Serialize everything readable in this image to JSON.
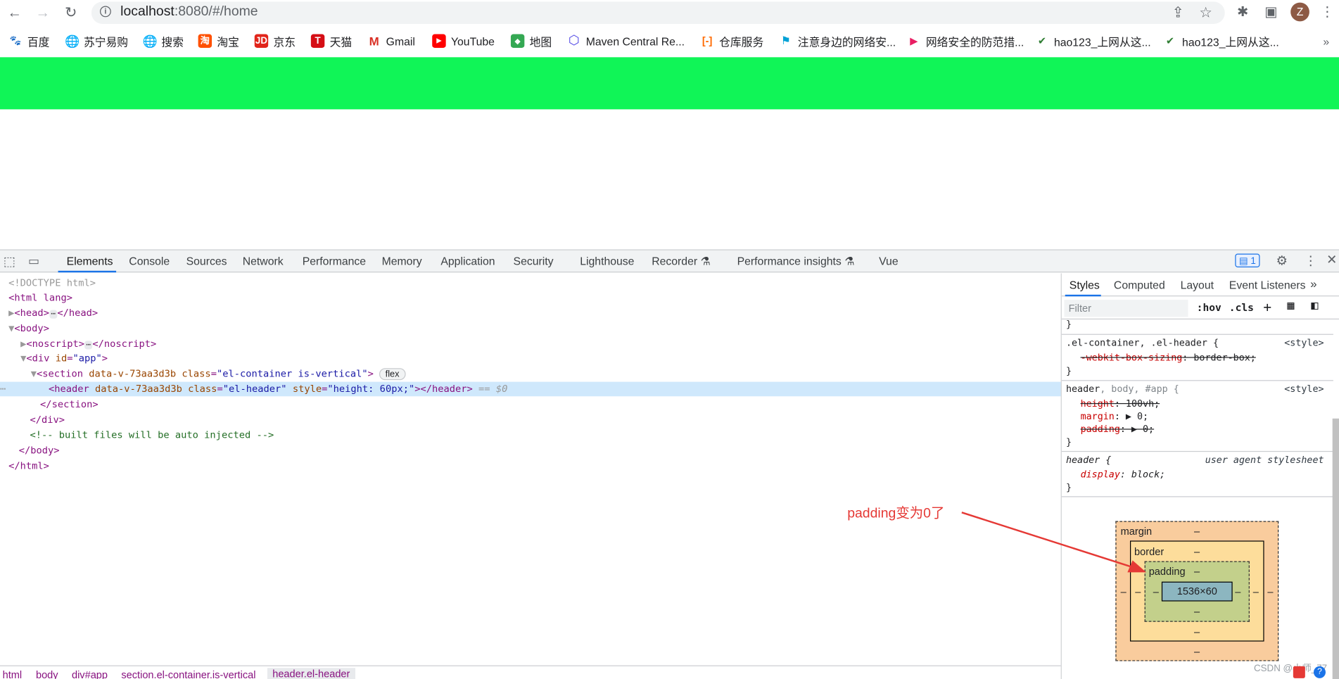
{
  "browser": {
    "url_host": "localhost",
    "url_rest": ":8080/#/home",
    "avatar_letter": "Z",
    "bookmarks": [
      {
        "label": "百度",
        "icon": "baidu-icon",
        "color": "#2932e1"
      },
      {
        "label": "苏宁易购",
        "icon": "globe-icon",
        "color": "#5f6368"
      },
      {
        "label": "搜索",
        "icon": "globe-icon",
        "color": "#5f6368"
      },
      {
        "label": "淘宝",
        "icon": "taobao-icon",
        "color": "#ff5000"
      },
      {
        "label": "京东",
        "icon": "jd-icon",
        "color": "#e1251b"
      },
      {
        "label": "天猫",
        "icon": "tmall-icon",
        "color": "#d50e15"
      },
      {
        "label": "Gmail",
        "icon": "gmail-icon",
        "color": "#d93025"
      },
      {
        "label": "YouTube",
        "icon": "youtube-icon",
        "color": "#ff0000"
      },
      {
        "label": "地图",
        "icon": "maps-icon",
        "color": "#34a853"
      },
      {
        "label": "Maven Central Re...",
        "icon": "maven-icon",
        "color": "#4f46e5"
      },
      {
        "label": "仓库服务",
        "icon": "aliyun-icon",
        "color": "#ff6a00"
      },
      {
        "label": "注意身边的网络安...",
        "icon": "bilibili-icon",
        "color": "#00a1d6"
      },
      {
        "label": "网络安全的防范措...",
        "icon": "video-icon",
        "color": "#e91e63"
      },
      {
        "label": "hao123_上网从这...",
        "icon": "hao123-icon",
        "color": "#2e7d32"
      },
      {
        "label": "hao123_上网从这...",
        "icon": "hao123-icon",
        "color": "#2e7d32"
      }
    ]
  },
  "page": {
    "header_color": "#10f557"
  },
  "devtools": {
    "tabs": [
      "Elements",
      "Console",
      "Sources",
      "Network",
      "Performance",
      "Memory",
      "Application",
      "Security",
      "Lighthouse",
      "Recorder",
      "Performance insights",
      "Vue"
    ],
    "issues_count": "1",
    "dom": {
      "doctype": "<!DOCTYPE html>",
      "html_open": "<html lang>",
      "head_open": "<head>",
      "head_close": "</head>",
      "body_open": "<body>",
      "noscript_open": "<noscript>",
      "noscript_close": "</noscript>",
      "div_open_tag": "<div ",
      "div_attr": "id",
      "div_attr_value": "\"app\"",
      "section_open_tag": "<section ",
      "section_attr1": "data-v-73aa3d3b",
      "section_attr2": "class",
      "section_attr2_value": "\"el-container is-vertical\"",
      "flex_badge": "flex",
      "header_open_tag": "<header ",
      "header_attr1": "data-v-73aa3d3b",
      "header_attr2": "class",
      "header_attr2_value": "\"el-header\"",
      "header_attr3": "style",
      "header_attr3_value": "\"height: 60px;\"",
      "header_close": "></header>",
      "selected_marker": " == $0",
      "section_close": "</section>",
      "div_close": "</div>",
      "comment": "<!-- built files will be auto injected -->",
      "body_close": "</body>",
      "html_close": "</html>"
    },
    "breadcrumbs": [
      "html",
      "body",
      "div#app",
      "section.el-container.is-vertical",
      "header.el-header"
    ],
    "sidebar_tabs": [
      "Styles",
      "Computed",
      "Layout",
      "Event Listeners"
    ],
    "filter_placeholder": "Filter",
    "hov_label": ":hov",
    "cls_label": ".cls",
    "styles": {
      "rule1_selector": ".el-container, .el-header {",
      "rule1_source": "<style>",
      "rule1_prop": "-webkit-box-sizing",
      "rule1_value": ": border-box;",
      "rule2_selector_a": "header",
      "rule2_selector_b": ", body, #app {",
      "rule2_source": "<style>",
      "rule2_prop1": "height",
      "rule2_value1": ": 100vh;",
      "rule2_prop2": "margin",
      "rule2_value2": ": ▶ 0;",
      "rule2_prop3": "padding",
      "rule2_value3": ": ▶ 0;",
      "rule3_selector": "header {",
      "rule3_source": "user agent stylesheet",
      "rule3_prop": "display",
      "rule3_value": ": block;",
      "close_brace": "}"
    },
    "box_model": {
      "margin_label": "margin",
      "border_label": "border",
      "padding_label": "padding",
      "dash": "–",
      "content_size": "1536×60"
    }
  },
  "annotation": {
    "text": "padding变为0了",
    "color": "#e53935"
  },
  "watermark": "CSDN @小师_77"
}
